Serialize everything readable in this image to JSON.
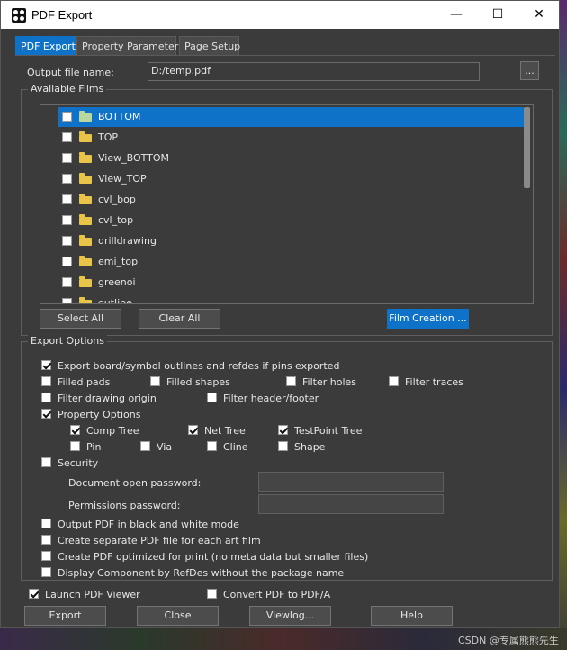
{
  "window": {
    "title": "PDF Export",
    "minimize": "—",
    "maximize": "☐",
    "close": "✕"
  },
  "tabs": [
    {
      "label": "PDF Export",
      "active": true
    },
    {
      "label": "Property Parameters",
      "active": false
    },
    {
      "label": "Page Setup",
      "active": false
    }
  ],
  "output": {
    "label": "Output file name:",
    "value": "D:/temp.pdf",
    "browse_label": "..."
  },
  "films": {
    "group_title": "Available Films",
    "items": [
      {
        "name": "BOTTOM",
        "checked": false,
        "selected": true
      },
      {
        "name": "TOP",
        "checked": false,
        "selected": false
      },
      {
        "name": "View_BOTTOM",
        "checked": false,
        "selected": false
      },
      {
        "name": "View_TOP",
        "checked": false,
        "selected": false
      },
      {
        "name": "cvl_bop",
        "checked": false,
        "selected": false
      },
      {
        "name": "cvl_top",
        "checked": false,
        "selected": false
      },
      {
        "name": "drilldrawing",
        "checked": false,
        "selected": false
      },
      {
        "name": "emi_top",
        "checked": false,
        "selected": false
      },
      {
        "name": "greenoi",
        "checked": false,
        "selected": false
      },
      {
        "name": "outline",
        "checked": false,
        "selected": false
      }
    ],
    "select_all": "Select All",
    "clear_all": "Clear All",
    "film_creation": "Film Creation ..."
  },
  "export_options": {
    "group_title": "Export Options",
    "export_outlines": {
      "label": "Export board/symbol outlines and refdes if pins exported",
      "checked": true
    },
    "filled_pads": {
      "label": "Filled pads",
      "checked": false
    },
    "filled_shapes": {
      "label": "Filled shapes",
      "checked": false
    },
    "filter_holes": {
      "label": "Filter holes",
      "checked": false
    },
    "filter_traces": {
      "label": "Filter traces",
      "checked": false
    },
    "filter_drawing_origin": {
      "label": "Filter drawing origin",
      "checked": false
    },
    "filter_header_footer": {
      "label": "Filter header/footer",
      "checked": false
    },
    "property_options": {
      "label": "Property Options",
      "checked": true
    },
    "comp_tree": {
      "label": "Comp Tree",
      "checked": true
    },
    "net_tree": {
      "label": "Net Tree",
      "checked": true
    },
    "testpoint_tree": {
      "label": "TestPoint Tree",
      "checked": true
    },
    "pin": {
      "label": "Pin",
      "checked": false
    },
    "via": {
      "label": "Via",
      "checked": false
    },
    "cline": {
      "label": "Cline",
      "checked": false
    },
    "shape": {
      "label": "Shape",
      "checked": false
    },
    "security": {
      "label": "Security",
      "checked": false
    },
    "doc_open_password": {
      "label": "Document open password:",
      "value": ""
    },
    "permissions_password": {
      "label": "Permissions password:",
      "value": ""
    },
    "bw_mode": {
      "label": "Output PDF in black and white mode",
      "checked": false
    },
    "separate_pdf": {
      "label": "Create separate PDF file for each art film",
      "checked": false
    },
    "optimized_print": {
      "label": "Create PDF optimized for print (no meta data but smaller files)",
      "checked": false
    },
    "display_refdes": {
      "label": "Display Component by RefDes without the package name",
      "checked": false
    }
  },
  "footer": {
    "launch_viewer": {
      "label": "Launch PDF Viewer",
      "checked": true
    },
    "convert_pdfa": {
      "label": "Convert PDF to PDF/A",
      "checked": false
    },
    "export": "Export",
    "close": "Close",
    "viewlog": "Viewlog...",
    "help": "Help"
  },
  "watermark": "CSDN @专属熊熊先生",
  "colors": {
    "accent": "#0e72c8",
    "panel": "#3b3b3b",
    "folder": "#e8c44a"
  }
}
